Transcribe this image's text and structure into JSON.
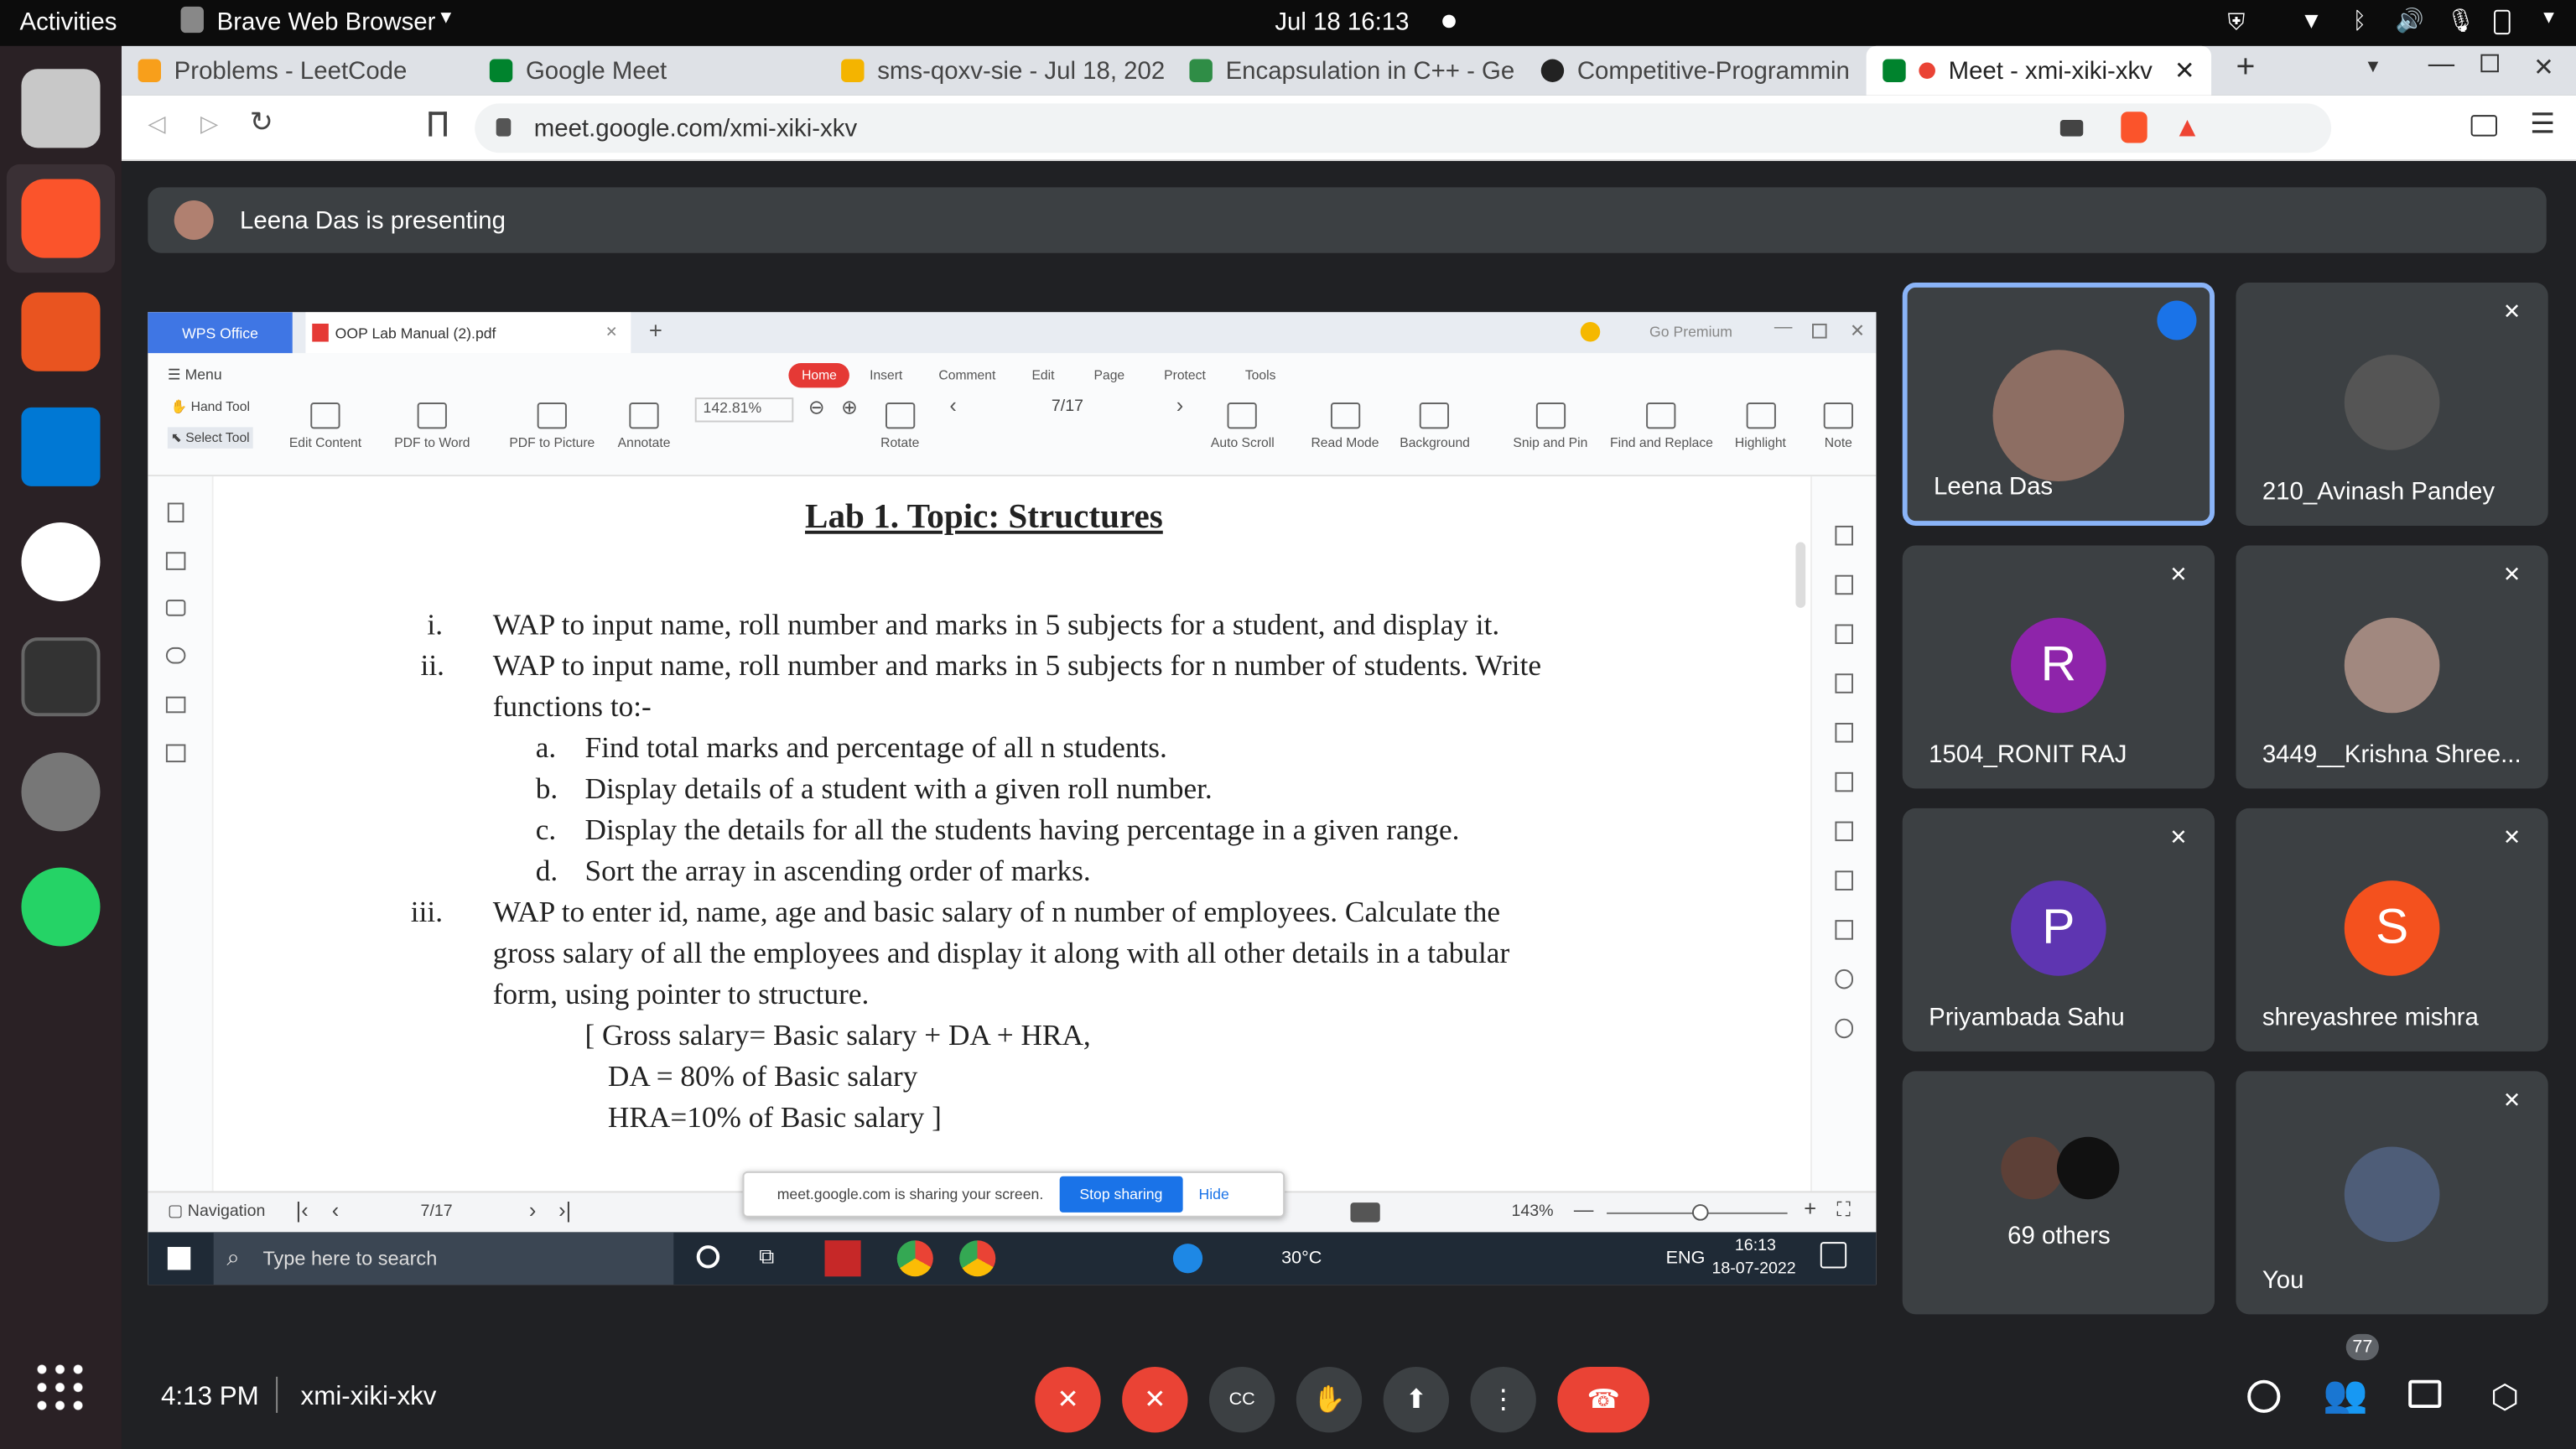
{
  "topbar": {
    "activities": "Activities",
    "app": "Brave Web Browser",
    "datetime": "Jul 18  16:13"
  },
  "tabs": [
    {
      "label": "Problems - LeetCode"
    },
    {
      "label": "Google Meet"
    },
    {
      "label": "sms-qoxv-sie - Jul 18, 202"
    },
    {
      "label": "Encapsulation in C++ - Ge"
    },
    {
      "label": "Competitive-Programmin"
    },
    {
      "label": "Meet - xmi-xiki-xkv"
    }
  ],
  "address": {
    "url": "meet.google.com/xmi-xiki-xkv"
  },
  "presenting": "Leena Das is presenting",
  "wps": {
    "app": "WPS Office",
    "file": "OOP Lab Manual (2).pdf",
    "go_premium": "Go Premium",
    "menu": "Menu",
    "menu_tabs": [
      "Home",
      "Insert",
      "Comment",
      "Edit",
      "Page",
      "Protect",
      "Tools"
    ],
    "hand_tool": "Hand Tool",
    "select_tool": "Select Tool",
    "tools": [
      "Edit Content",
      "PDF to Word",
      "PDF to Picture",
      "Annotate"
    ],
    "zoom": "142.81%",
    "rotate": "Rotate",
    "page": "7/17",
    "tools_right": [
      "Auto Scroll",
      "Read Mode",
      "Background",
      "Snip and Pin",
      "Find and Replace",
      "Highlight",
      "Note"
    ],
    "navigation": "Navigation",
    "page_status": "7/17",
    "zoom_status": "143%"
  },
  "doc": {
    "title": "Lab 1.   Topic: Structures",
    "lines": [
      {
        "num": "i.",
        "text": "WAP to input name, roll number and marks in 5 subjects for a student, and display it."
      },
      {
        "num": "ii.",
        "text": "WAP to input name, roll number and marks in 5 subjects for n number of students. Write"
      },
      {
        "num": "",
        "text": "functions to:-"
      },
      {
        "num": "a.",
        "text": "Find total marks and percentage of all n students."
      },
      {
        "num": "b.",
        "text": "Display details of a student with a given roll number."
      },
      {
        "num": "c.",
        "text": "Display the details for all the students having percentage in a given range."
      },
      {
        "num": "d.",
        "text": "Sort the array in ascending order of marks."
      },
      {
        "num": "iii.",
        "text": "WAP to enter id, name, age and basic salary of n number of employees. Calculate the"
      },
      {
        "num": "",
        "text": "gross salary of all the employees and display it along with all other details in a tabular"
      },
      {
        "num": "",
        "text": "form, using pointer to structure."
      },
      {
        "num": "",
        "text": "[ Gross salary= Basic salary + DA + HRA,"
      },
      {
        "num": "",
        "text": "DA = 80% of Basic salary"
      },
      {
        "num": "",
        "text": "HRA=10% of Basic salary ]"
      }
    ]
  },
  "share_notice": {
    "text": "meet.google.com is sharing your screen.",
    "stop": "Stop sharing",
    "hide": "Hide"
  },
  "win_taskbar": {
    "search": "Type here to search",
    "temp": "30°C",
    "lang": "ENG",
    "time": "16:13",
    "date": "18-07-2022"
  },
  "participants": [
    {
      "name": "Leena Das",
      "initial": "",
      "color": "#8d6e63",
      "speaking": true
    },
    {
      "name": "210_Avinash Pandey",
      "initial": "",
      "color": "#555555"
    },
    {
      "name": "1504_RONIT RAJ",
      "initial": "R",
      "color": "#8e24aa"
    },
    {
      "name": "3449__Krishna Shree...",
      "initial": "",
      "color": "#a1887f"
    },
    {
      "name": "Priyambada Sahu",
      "initial": "P",
      "color": "#5e35b1"
    },
    {
      "name": "shreyashree mishra",
      "initial": "S",
      "color": "#f4511e"
    },
    {
      "name": "69 others",
      "initial": "",
      "color": "#5d4037"
    },
    {
      "name": "You",
      "initial": "",
      "color": "#4e5d78"
    }
  ],
  "bottom": {
    "time": "4:13 PM",
    "code": "xmi-xiki-xkv",
    "people_count": "77"
  }
}
